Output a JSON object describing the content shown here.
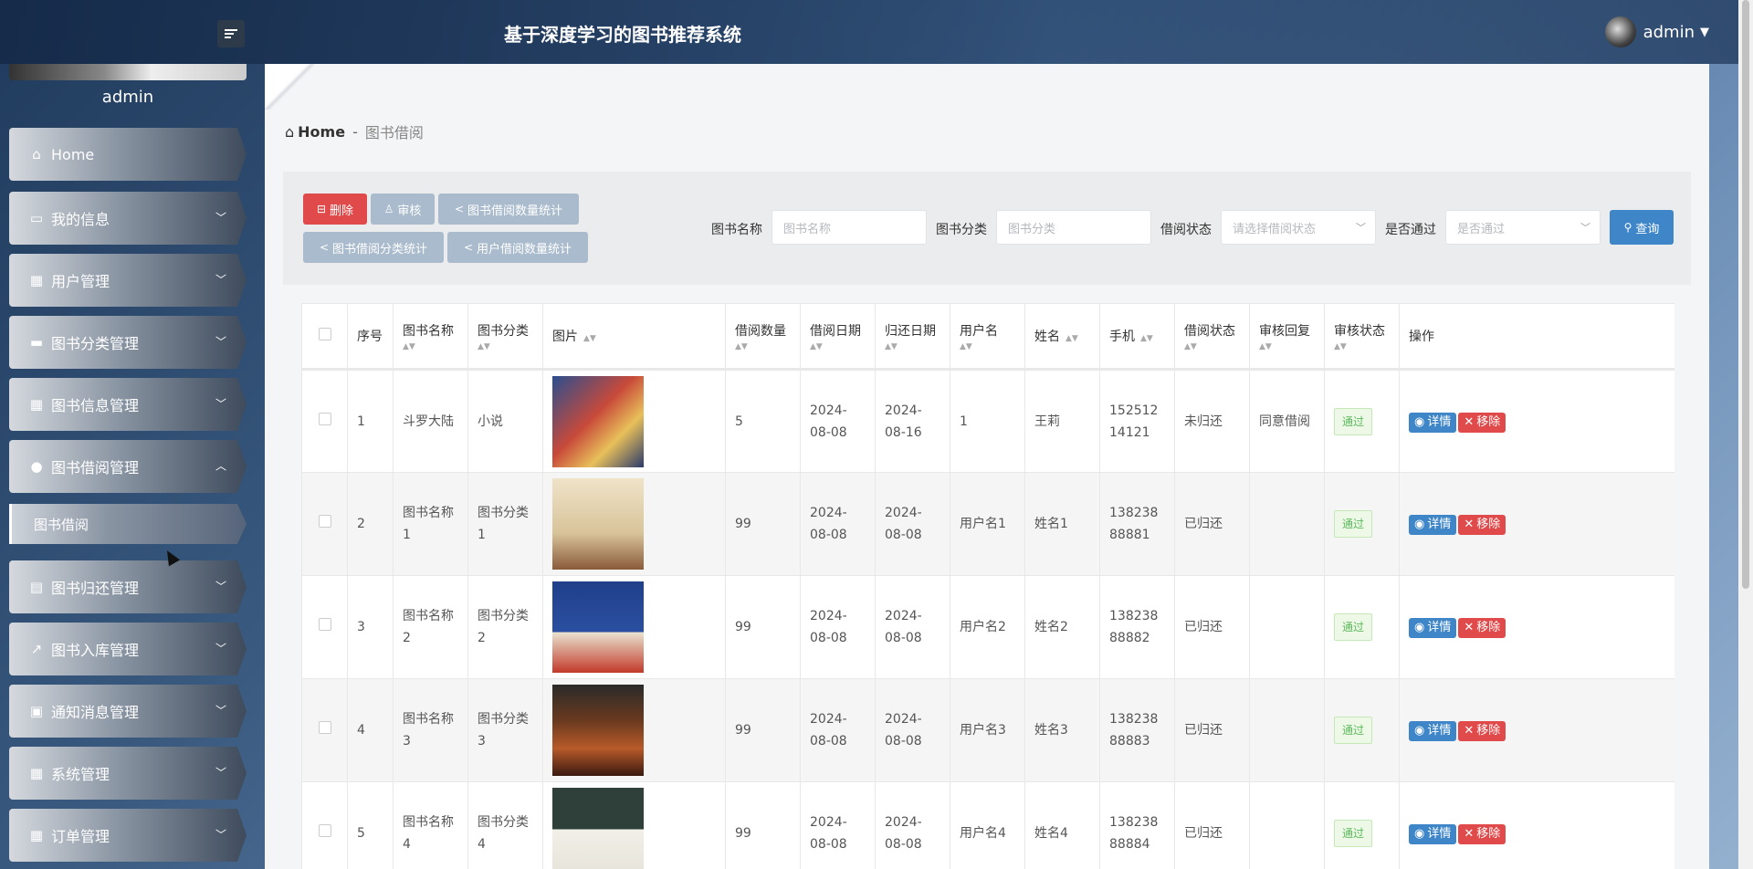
{
  "header": {
    "title": "基于深度学习的图书推荐系统",
    "user": "admin"
  },
  "sidebar": {
    "username": "admin",
    "items": [
      {
        "label": "Home",
        "icon": "home-icon"
      },
      {
        "label": "我的信息",
        "icon": "id-card-icon"
      },
      {
        "label": "用户管理",
        "icon": "grid-icon"
      },
      {
        "label": "图书分类管理",
        "icon": "briefcase-icon"
      },
      {
        "label": "图书信息管理",
        "icon": "grid-icon"
      },
      {
        "label": "图书借阅管理",
        "icon": "user-icon"
      },
      {
        "label": "图书归还管理",
        "icon": "printer-icon"
      },
      {
        "label": "图书入库管理",
        "icon": "chart-icon"
      },
      {
        "label": "通知消息管理",
        "icon": "clipboard-icon"
      },
      {
        "label": "系统管理",
        "icon": "grid-icon"
      },
      {
        "label": "订单管理",
        "icon": "grid-icon"
      }
    ],
    "subitem": "图书借阅"
  },
  "breadcrumb": {
    "home": "Home",
    "sep": "-",
    "current": "图书借阅"
  },
  "toolbar": {
    "delete": "删除",
    "audit": "审核",
    "stat_count": "图书借阅数量统计",
    "stat_category": "图书借阅分类统计",
    "stat_user": "用户借阅数量统计"
  },
  "filters": {
    "name_label": "图书名称",
    "name_placeholder": "图书名称",
    "category_label": "图书分类",
    "category_placeholder": "图书分类",
    "status_label": "借阅状态",
    "status_placeholder": "请选择借阅状态",
    "pass_label": "是否通过",
    "pass_placeholder": "是否通过",
    "search": "查询"
  },
  "table": {
    "headers": [
      "序号",
      "图书名称",
      "图书分类",
      "图片",
      "借阅数量",
      "借阅日期",
      "归还日期",
      "用户名",
      "姓名",
      "手机",
      "借阅状态",
      "审核回复",
      "审核状态",
      "操作"
    ],
    "detail_label": "详情",
    "remove_label": "移除",
    "rows": [
      {
        "no": "1",
        "name": "斗罗大陆",
        "category": "小说",
        "qty": "5",
        "borrow_date": "2024-08-08",
        "return_date": "2024-08-16",
        "username": "1",
        "realname": "王莉",
        "phone": "15251214121",
        "status": "未归还",
        "reply": "同意借阅",
        "audit": "通过"
      },
      {
        "no": "2",
        "name": "图书名称1",
        "category": "图书分类1",
        "qty": "99",
        "borrow_date": "2024-08-08",
        "return_date": "2024-08-08",
        "username": "用户名1",
        "realname": "姓名1",
        "phone": "13823888881",
        "status": "已归还",
        "reply": "",
        "audit": "通过"
      },
      {
        "no": "3",
        "name": "图书名称2",
        "category": "图书分类2",
        "qty": "99",
        "borrow_date": "2024-08-08",
        "return_date": "2024-08-08",
        "username": "用户名2",
        "realname": "姓名2",
        "phone": "13823888882",
        "status": "已归还",
        "reply": "",
        "audit": "通过"
      },
      {
        "no": "4",
        "name": "图书名称3",
        "category": "图书分类3",
        "qty": "99",
        "borrow_date": "2024-08-08",
        "return_date": "2024-08-08",
        "username": "用户名3",
        "realname": "姓名3",
        "phone": "13823888883",
        "status": "已归还",
        "reply": "",
        "audit": "通过"
      },
      {
        "no": "5",
        "name": "图书名称4",
        "category": "图书分类4",
        "qty": "99",
        "borrow_date": "2024-08-08",
        "return_date": "2024-08-08",
        "username": "用户名4",
        "realname": "姓名4",
        "phone": "13823888884",
        "status": "已归还",
        "reply": "",
        "audit": "通过"
      }
    ]
  }
}
